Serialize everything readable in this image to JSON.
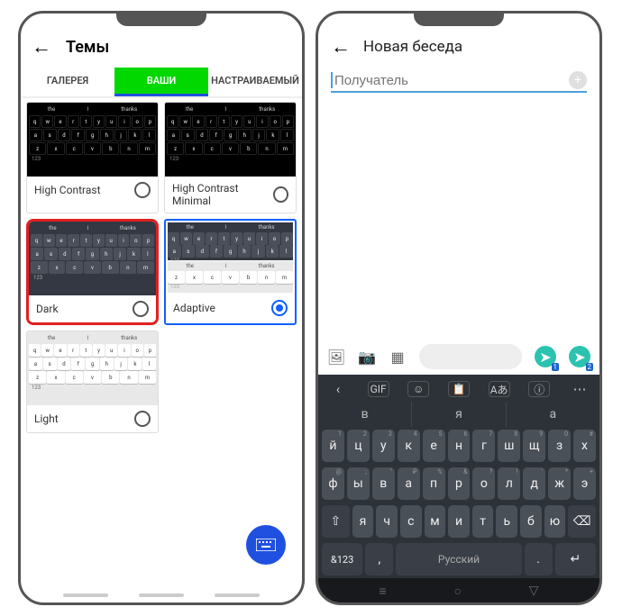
{
  "left": {
    "title": "Темы",
    "tabs": [
      "ГАЛЕРЕЯ",
      "ВАШИ",
      "НАСТРАИВАЕМЫЙ"
    ],
    "active_tab": 1,
    "suggestions": [
      "the",
      "I",
      "thanks"
    ],
    "row1": [
      "q",
      "w",
      "e",
      "r",
      "t",
      "y",
      "u",
      "i",
      "o",
      "p"
    ],
    "row2": [
      "a",
      "s",
      "d",
      "f",
      "g",
      "h",
      "j",
      "k",
      "l"
    ],
    "row3": [
      "z",
      "x",
      "c",
      "v",
      "b",
      "n",
      "m"
    ],
    "num_label": "123",
    "themes": [
      {
        "name": "High Contrast",
        "selected": false,
        "style": "dark"
      },
      {
        "name": "High Contrast Minimal",
        "selected": false,
        "style": "dark"
      },
      {
        "name": "Dark",
        "selected": false,
        "style": "dim",
        "highlighted": true
      },
      {
        "name": "Adaptive",
        "selected": true,
        "style": "split"
      },
      {
        "name": "Light",
        "selected": false,
        "style": "light"
      }
    ]
  },
  "right": {
    "title": "Новая беседа",
    "recipient_placeholder": "Получатель",
    "toolbar": [
      "GIF",
      "☺",
      "📋",
      "Aあ",
      "ⓘ"
    ],
    "predictions": [
      "в",
      "я",
      "а"
    ],
    "row1": [
      {
        "l": "й",
        "s": "1"
      },
      {
        "l": "ц",
        "s": "2"
      },
      {
        "l": "у",
        "s": "3"
      },
      {
        "l": "к",
        "s": "4"
      },
      {
        "l": "е",
        "s": "5"
      },
      {
        "l": "н",
        "s": "6"
      },
      {
        "l": "г",
        "s": "7"
      },
      {
        "l": "ш",
        "s": "8"
      },
      {
        "l": "щ",
        "s": "9"
      },
      {
        "l": "з",
        "s": "0"
      },
      {
        "l": "х",
        "s": "#"
      }
    ],
    "row2": [
      {
        "l": "ф",
        "s": "@"
      },
      {
        "l": "ы",
        "s": ";"
      },
      {
        "l": "в",
        "s": "\""
      },
      {
        "l": "а",
        "s": "₽"
      },
      {
        "l": "п",
        "s": "%"
      },
      {
        "l": "р",
        "s": "&"
      },
      {
        "l": "о",
        "s": "?"
      },
      {
        "l": "л",
        "s": "!"
      },
      {
        "l": "д",
        "s": "'"
      },
      {
        "l": "ж",
        "s": "*"
      },
      {
        "l": "э",
        "s": "+"
      }
    ],
    "row3": [
      {
        "l": "я",
        "s": ""
      },
      {
        "l": "ч",
        "s": ""
      },
      {
        "l": "с",
        "s": ""
      },
      {
        "l": "м",
        "s": ""
      },
      {
        "l": "и",
        "s": ""
      },
      {
        "l": "т",
        "s": ""
      },
      {
        "l": "ь",
        "s": ""
      },
      {
        "l": "б",
        "s": ""
      },
      {
        "l": "ю",
        "s": ""
      }
    ],
    "bottom": {
      "sym": "&123",
      "comma": ",",
      "space": "Русский",
      "dot": ".",
      "enter": "↵"
    },
    "send_badges": [
      1,
      2
    ]
  }
}
